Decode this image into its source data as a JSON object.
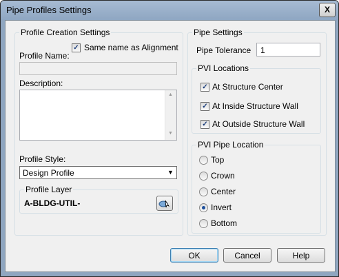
{
  "window": {
    "title": "Pipe Profiles Settings",
    "close_glyph": "X"
  },
  "profile_creation": {
    "legend": "Profile Creation Settings",
    "same_name_label": "Same name as Alignment",
    "same_name_checked": true,
    "profile_name_label": "Profile Name:",
    "profile_name_value": "",
    "description_label": "Description:",
    "description_value": "",
    "profile_style_label": "Profile Style:",
    "profile_style_value": "Design Profile",
    "profile_layer_legend": "Profile Layer",
    "profile_layer_value": "A-BLDG-UTIL-"
  },
  "pipe_settings": {
    "legend": "Pipe Settings",
    "tolerance_label": "Pipe Tolerance",
    "tolerance_value": "1",
    "pvi_locations": {
      "legend": "PVI Locations",
      "items": [
        {
          "label": "At Structure Center",
          "checked": true
        },
        {
          "label": "At Inside Structure Wall",
          "checked": true
        },
        {
          "label": "At Outside Structure Wall",
          "checked": true
        }
      ]
    },
    "pvi_pipe_location": {
      "legend": "PVI Pipe Location",
      "options": [
        {
          "label": "Top",
          "selected": false
        },
        {
          "label": "Crown",
          "selected": false
        },
        {
          "label": "Center",
          "selected": false
        },
        {
          "label": "Invert",
          "selected": true
        },
        {
          "label": "Bottom",
          "selected": false
        }
      ]
    }
  },
  "buttons": {
    "ok": "OK",
    "cancel": "Cancel",
    "help": "Help"
  },
  "icons": {
    "check": "✓",
    "dropdown": "▼",
    "scroll_up": "▲",
    "scroll_down": "▼"
  }
}
